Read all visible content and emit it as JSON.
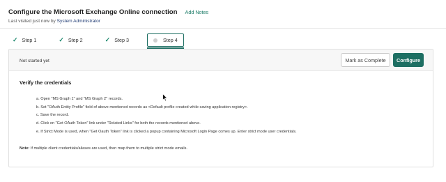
{
  "header": {
    "title": "Configure the Microsoft Exchange Online connection",
    "add_notes": "Add Notes",
    "last_visited_prefix": "Last visited just now by",
    "last_visited_user": "System Administrator"
  },
  "steps": [
    {
      "label": "Step 1",
      "state": "completed",
      "icon": "checkmark-icon"
    },
    {
      "label": "Step 2",
      "state": "completed",
      "icon": "checkmark-icon"
    },
    {
      "label": "Step 3",
      "state": "completed",
      "icon": "checkmark-icon"
    },
    {
      "label": "Step 4",
      "state": "active",
      "icon": "status-dot-icon"
    }
  ],
  "card": {
    "status": "Not started yet",
    "mark_complete_label": "Mark as Complete",
    "configure_label": "Configure",
    "section_title": "Verify the credentials",
    "instructions": [
      "a. Open \"MS Graph 1\" and \"MS Graph 2\" records.",
      "b. Set \"OAuth Entity Profile\" field of above mentioned records as <Default profile created while saving application registry>.",
      "c. Save the record.",
      "d. Click on \"Get OAuth Token\" link under \"Related Links\" for both the records mentioned above.",
      "e. If Strict Mode is used, when \"Get Oauth Token\" link is clicked a popup containing Microsoft Login Page comes up. Enter strict mode user credentials."
    ],
    "note_label": "Note:",
    "note_text": " If multiple client credentials/aliases are used, then map them to multiple strict mode emails."
  },
  "colors": {
    "accent": "#1e6f63",
    "link": "#1a7a66",
    "check": "#1e8a6f"
  }
}
